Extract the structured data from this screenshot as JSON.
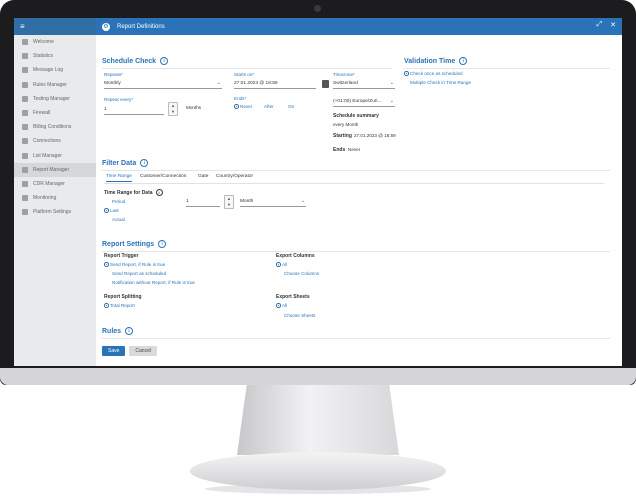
{
  "sidebar": {
    "items": [
      {
        "label": "Welcome",
        "icon": "home-icon"
      },
      {
        "label": "Statistics",
        "icon": "chart-icon"
      },
      {
        "label": "Message Log",
        "icon": "log-icon"
      },
      {
        "label": "Rules Manager",
        "icon": "rules-icon"
      },
      {
        "label": "Testing Manager",
        "icon": "test-icon"
      },
      {
        "label": "Firewall",
        "icon": "firewall-icon"
      },
      {
        "label": "Billing Conditions",
        "icon": "billing-icon"
      },
      {
        "label": "Connections",
        "icon": "connection-icon"
      },
      {
        "label": "List Manager",
        "icon": "list-icon"
      },
      {
        "label": "Report Manager",
        "icon": "report-icon"
      },
      {
        "label": "CDR Manager",
        "icon": "cdr-icon"
      },
      {
        "label": "Monitoring",
        "icon": "monitor-icon"
      },
      {
        "label": "Platform Settings",
        "icon": "settings-icon"
      }
    ],
    "active_index": 9
  },
  "dialog": {
    "title": "Report Definitions"
  },
  "schedule": {
    "title": "Schedule Check",
    "repeats_label": "Repeats*",
    "repeats_value": "Monthly",
    "starts_label": "Starts on*",
    "starts_value": "27.01.2023 @ 18:59",
    "timezone_label": "Timezone*",
    "timezone_value": "Switzerland",
    "timezone_detail": "(+01:00) Europe/Zuri...",
    "repeat_every_label": "Repeat every*",
    "repeat_every_value": "1",
    "repeat_every_unit": "Months",
    "ends_label": "Ends*",
    "ends_options": [
      "Never",
      "After",
      "On"
    ],
    "summary_title": "Schedule summary",
    "summary_value": "every Month",
    "starting_label": "Starting",
    "starting_value": "27.01.2023 @ 18:59",
    "ends_summary_label": "Ends",
    "ends_summary_value": "Never"
  },
  "validation": {
    "title": "Validation Time",
    "options": [
      "Check once as scheduled",
      "Multiple Check in Time Range"
    ]
  },
  "filter": {
    "title": "Filter Data",
    "tabs": [
      "Time Range",
      "Customer/Connection",
      "Gate",
      "Country/Operator"
    ],
    "time_range_label": "Time Range for Data",
    "period_label": "Period",
    "last_label": "Last",
    "actual_label": "Actual",
    "amount_value": "1",
    "unit_value": "Month"
  },
  "report_settings": {
    "title": "Report Settings",
    "trigger_title": "Report Trigger",
    "trigger_options": [
      "Send Report, if Rule is true",
      "Send Report as scheduled",
      "Notification without Report, if Rule is true"
    ],
    "export_columns_title": "Export Columns",
    "export_columns_options": [
      "All",
      "Choose Columns"
    ],
    "splitting_title": "Report Splitting",
    "splitting_options": [
      "Total Report"
    ],
    "export_sheets_title": "Export Sheets",
    "export_sheets_options": [
      "All",
      "Choose Sheets"
    ]
  },
  "rules": {
    "title": "Rules"
  },
  "footer": {
    "save_label": "Save",
    "cancel_label": "Cancel"
  },
  "colors": {
    "accent": "#2b73b8",
    "sidebar_bg": "#e9eaec",
    "bezel": "#1c1c1e"
  }
}
